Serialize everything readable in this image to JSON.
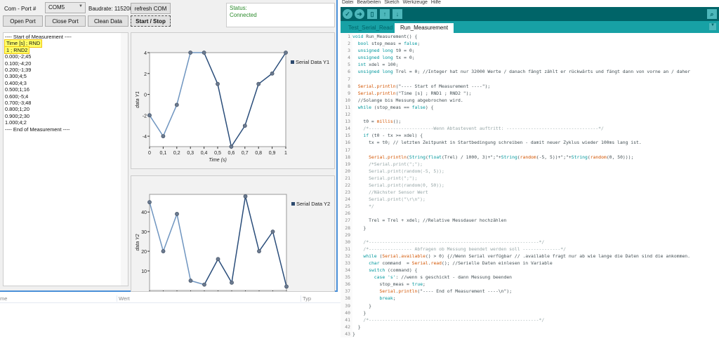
{
  "app": {
    "port_label": "Com - Port #",
    "port_value": "COM5",
    "baud_label": "Baudrate: 115200",
    "refresh_label": "refresh COM",
    "open_label": "Open Port",
    "close_label": "Close Port",
    "clean_label": "Clean Data",
    "start_stop_label": "Start / Stop",
    "status_title": "Status:",
    "status_value": "Connected",
    "log_lines": [
      "---- Start of Measurement ----",
      "Time [s] ; RND",
      "1 ; RND2",
      "0.000;-2;45",
      "0.100;-4;20",
      "0.200;-1;39",
      "0.300;4;5",
      "0.400;4;3",
      "0.500;1;16",
      "0.600;-5;4",
      "0.700;-3;48",
      "0.800;1;20",
      "0.900;2;30",
      "1.000;4;2",
      "---- End of Measurement ----"
    ],
    "colors": {
      "line": "#2a4d7a",
      "status": "#2a8a2a",
      "highlight": "#ffff66"
    }
  },
  "chart_data": [
    {
      "type": "line",
      "legend": "Serial Data Y1",
      "ylabel": "data Y1",
      "xlabel": "Time (s)",
      "x": [
        0,
        0.1,
        0.2,
        0.3,
        0.4,
        0.5,
        0.6,
        0.7,
        0.8,
        0.9,
        1
      ],
      "values": [
        -2,
        -4,
        -1,
        4,
        4,
        1,
        -5,
        -3,
        1,
        2,
        4
      ],
      "yticks": [
        -4,
        -2,
        0,
        2,
        4
      ],
      "xticks": [
        "0",
        "0,1",
        "0,2",
        "0,3",
        "0,4",
        "0,5",
        "0,6",
        "0,7",
        "0,8",
        "0,9",
        "1"
      ],
      "ylim": [
        -5,
        4
      ],
      "xlim": [
        0,
        1
      ],
      "legend_position": "right"
    },
    {
      "type": "line",
      "legend": "Serial Data Y2",
      "ylabel": "data Y2",
      "x": [
        0,
        0.1,
        0.2,
        0.3,
        0.4,
        0.5,
        0.6,
        0.7,
        0.8,
        0.9,
        1
      ],
      "values": [
        45,
        20,
        39,
        5,
        3,
        16,
        4,
        48,
        20,
        30,
        2
      ],
      "yticks": [
        10,
        20,
        30,
        40
      ],
      "ylim": [
        0,
        49
      ],
      "xlim": [
        0,
        1
      ],
      "legend_position": "right"
    }
  ],
  "lower_panel": {
    "col_name": "me",
    "col_value": "Wert",
    "col_type": "Typ"
  },
  "ide": {
    "menu": [
      "Datei",
      "Bearbeiten",
      "Sketch",
      "Werkzeuge",
      "Hilfe"
    ],
    "tabs": [
      "Test_Serial_Read",
      "Run_Measurement"
    ],
    "code": [
      [
        [
          "k",
          "void"
        ],
        [
          "t",
          " Run_Measurement() {"
        ]
      ],
      [
        [
          "t",
          "  "
        ],
        [
          "k",
          "bool"
        ],
        [
          "t",
          " stop_meas = "
        ],
        [
          "k",
          "false"
        ],
        [
          "t",
          ";"
        ]
      ],
      [
        [
          "t",
          "  "
        ],
        [
          "k",
          "unsigned long"
        ],
        [
          "t",
          " t0 = 0;"
        ]
      ],
      [
        [
          "t",
          "  "
        ],
        [
          "k",
          "unsigned long"
        ],
        [
          "t",
          " tx = 0;"
        ]
      ],
      [
        [
          "t",
          "  "
        ],
        [
          "k",
          "int"
        ],
        [
          "t",
          " xdel = 100;"
        ]
      ],
      [
        [
          "t",
          "  "
        ],
        [
          "k",
          "unsigned long"
        ],
        [
          "t",
          " Trel = 0; //Integer hat nur 32000 Werte / danach fängt zählt er rückwärts und fängt dann von vorne an / daher"
        ]
      ],
      [],
      [
        [
          "t",
          "  "
        ],
        [
          "f",
          "Serial"
        ],
        [
          "t",
          "."
        ],
        [
          "f",
          "println"
        ],
        [
          "t",
          "(\"---- Start of Measurement ----\");"
        ]
      ],
      [
        [
          "t",
          "  "
        ],
        [
          "f",
          "Serial"
        ],
        [
          "t",
          "."
        ],
        [
          "f",
          "println"
        ],
        [
          "t",
          "(\"Time [s] ; RND1 ; RND2 \");"
        ]
      ],
      [
        [
          "t",
          "  //Solange bis Messung abgebrochen wird."
        ]
      ],
      [
        [
          "t",
          "  "
        ],
        [
          "k",
          "while"
        ],
        [
          "t",
          " (stop_meas == "
        ],
        [
          "k",
          "false"
        ],
        [
          "t",
          ") {"
        ]
      ],
      [],
      [
        [
          "t",
          "    t0 = "
        ],
        [
          "f",
          "millis"
        ],
        [
          "t",
          "();"
        ]
      ],
      [
        [
          "c",
          "    /*------------------------Wenn Abtastevent auftritt: ----------------------------------*/"
        ]
      ],
      [
        [
          "t",
          "    "
        ],
        [
          "k",
          "if"
        ],
        [
          "t",
          " (t0 - tx >= xdel) {"
        ]
      ],
      [
        [
          "t",
          "      tx = t0; // letzten Zeitpunkt in Startbedingung schreiben - damit neuer Zyklus wieder 100ms lang ist."
        ]
      ],
      [],
      [
        [
          "t",
          "      "
        ],
        [
          "f",
          "Serial"
        ],
        [
          "t",
          "."
        ],
        [
          "f",
          "println"
        ],
        [
          "t",
          "("
        ],
        [
          "k",
          "String"
        ],
        [
          "t",
          "("
        ],
        [
          "k",
          "float"
        ],
        [
          "t",
          "(Trel) / 1000, 3)+\";\"+"
        ],
        [
          "k",
          "String"
        ],
        [
          "t",
          "("
        ],
        [
          "f",
          "random"
        ],
        [
          "t",
          "(-5, 5))+\";\"+"
        ],
        [
          "k",
          "String"
        ],
        [
          "t",
          "("
        ],
        [
          "f",
          "random"
        ],
        [
          "t",
          "(0, 50)));"
        ]
      ],
      [
        [
          "c",
          "      /*Serial.print(\";\");"
        ]
      ],
      [
        [
          "c",
          "      Serial.print(random(-5, 5));"
        ]
      ],
      [
        [
          "c",
          "      Serial.print(\";\");"
        ]
      ],
      [
        [
          "c",
          "      Serial.print(random(0, 50));"
        ]
      ],
      [
        [
          "c",
          "      //Nächster Sensor Wert"
        ]
      ],
      [
        [
          "c",
          "      Serial.print(\"\\r\\n\");"
        ]
      ],
      [
        [
          "c",
          "      */"
        ]
      ],
      [],
      [
        [
          "t",
          "      Trel = Trel + xdel; //Relative Messdauer hochzählen"
        ]
      ],
      [
        [
          "t",
          "    }"
        ]
      ],
      [],
      [
        [
          "c",
          "    /*---------------------------------------------------------------*/"
        ]
      ],
      [
        [
          "c",
          "    /*---------------- Abfragen ob Messung beendet werden soll --------------*/"
        ]
      ],
      [
        [
          "t",
          "    "
        ],
        [
          "k",
          "while"
        ],
        [
          "t",
          " ("
        ],
        [
          "f",
          "Serial"
        ],
        [
          "t",
          "."
        ],
        [
          "f",
          "available"
        ],
        [
          "t",
          "() > 0) {//Wenn Serial verfügbar // .available fragt nur ab wie lange die Daten sind die ankommen."
        ]
      ],
      [
        [
          "t",
          "      "
        ],
        [
          "k",
          "char"
        ],
        [
          "t",
          " command  = "
        ],
        [
          "f",
          "Serial"
        ],
        [
          "t",
          "."
        ],
        [
          "f",
          "read"
        ],
        [
          "t",
          "(); //Serielle Daten einlesen in Variable"
        ]
      ],
      [
        [
          "t",
          "      "
        ],
        [
          "k",
          "switch"
        ],
        [
          "t",
          " (command) {"
        ]
      ],
      [
        [
          "t",
          "        "
        ],
        [
          "k",
          "case"
        ],
        [
          "t",
          " "
        ],
        [
          "k",
          "'s'"
        ],
        [
          "t",
          ": //wenn s geschickt - dann Messung beenden"
        ]
      ],
      [
        [
          "t",
          "          stop_meas = "
        ],
        [
          "k",
          "true"
        ],
        [
          "t",
          ";"
        ]
      ],
      [
        [
          "t",
          "          "
        ],
        [
          "f",
          "Serial"
        ],
        [
          "t",
          "."
        ],
        [
          "f",
          "println"
        ],
        [
          "t",
          "(\"---- End of Measurement ----\\n\");"
        ]
      ],
      [
        [
          "t",
          "          "
        ],
        [
          "k",
          "break"
        ],
        [
          "t",
          ";"
        ]
      ],
      [
        [
          "t",
          "      }"
        ]
      ],
      [
        [
          "t",
          "    }"
        ]
      ],
      [
        [
          "c",
          "    /*---------------------------------------------------------------*/"
        ]
      ],
      [
        [
          "t",
          "  }"
        ]
      ],
      [
        [
          "t",
          "}"
        ]
      ]
    ]
  }
}
